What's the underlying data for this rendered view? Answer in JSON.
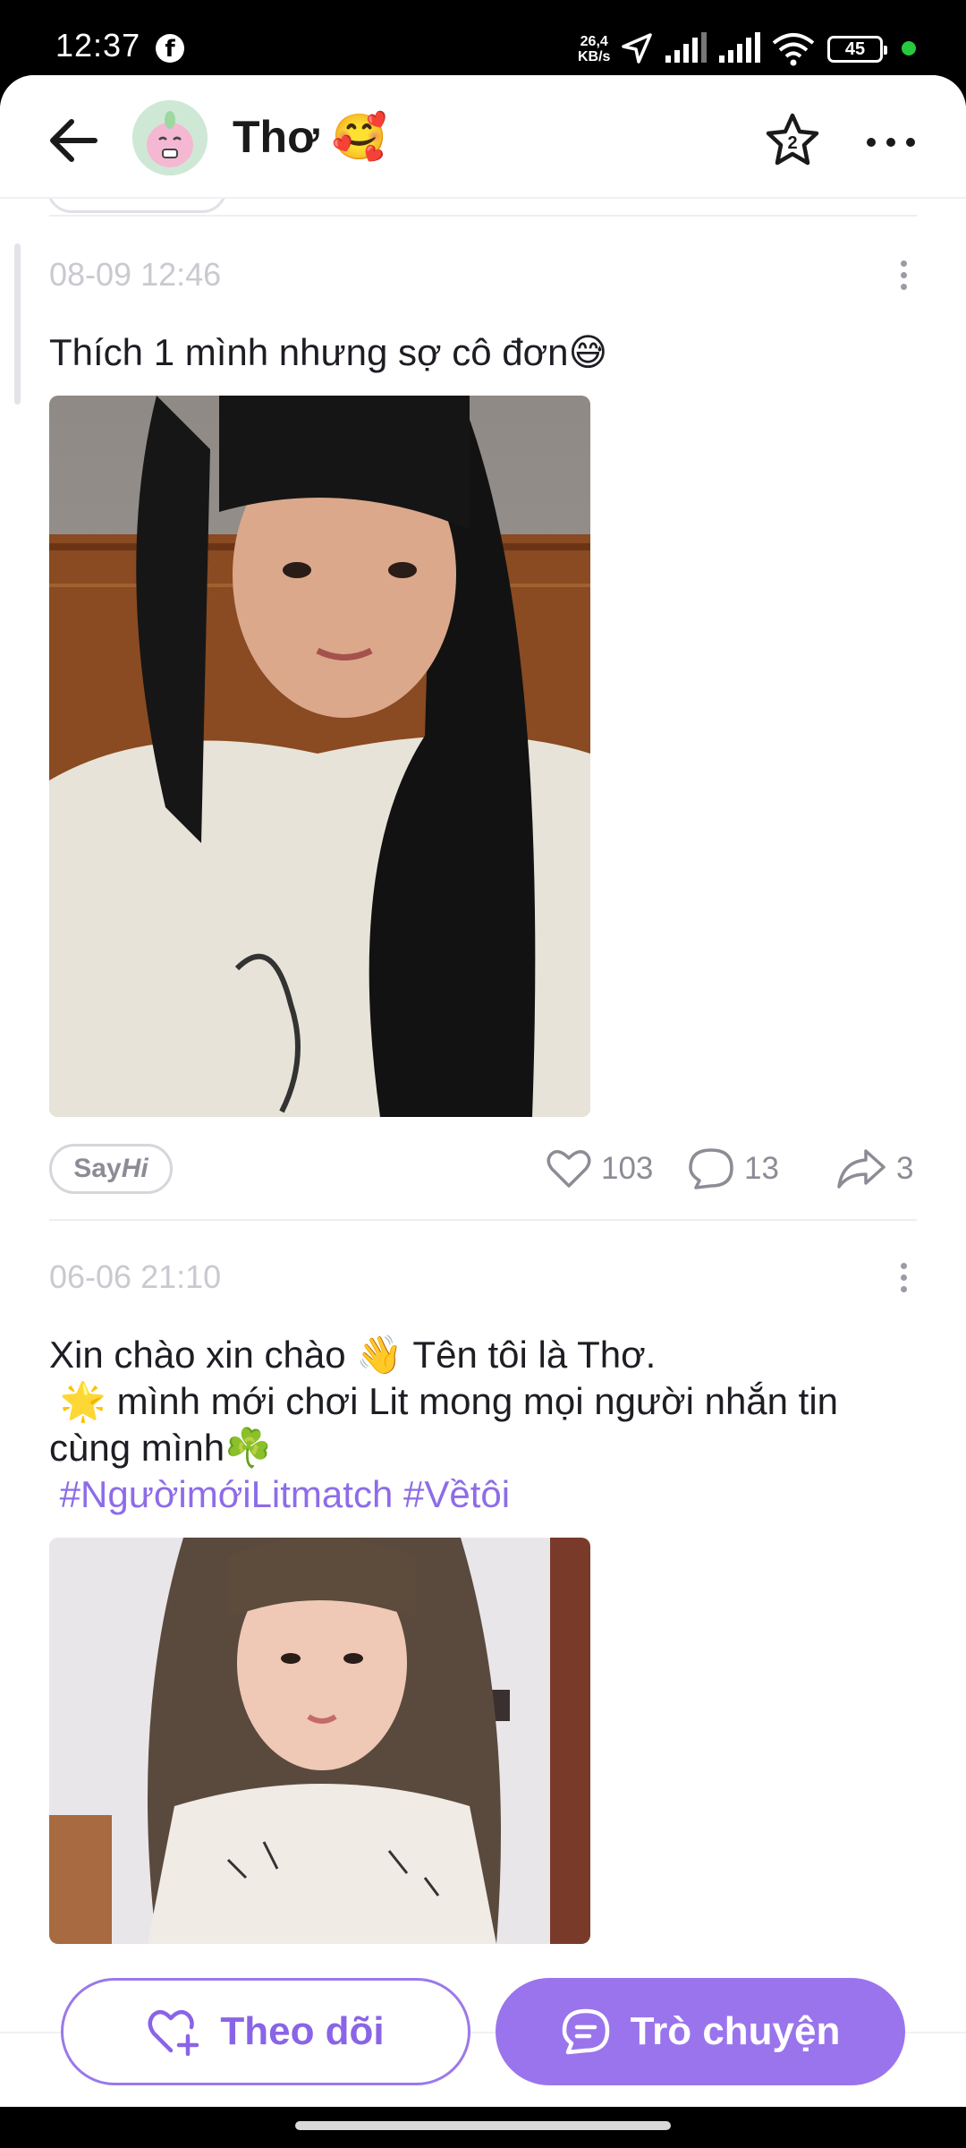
{
  "status_bar": {
    "time": "12:37",
    "net_speed_value": "26,4",
    "net_speed_unit": "KB/s",
    "battery": "45"
  },
  "header": {
    "username": "Thơ 🥰",
    "star_badge": "2"
  },
  "posts": [
    {
      "date": "08-09 12:46",
      "text": "Thích 1 mình nhưng sợ cô đơn😅",
      "hashtags": "",
      "sayhi_label": "Say",
      "sayhi_label_italic": "Hi",
      "likes": "103",
      "comments": "13",
      "shares": "3"
    },
    {
      "date": "06-06 21:10",
      "text_line1": "Xin chào xin chào 👋 Tên tôi là Thơ.",
      "text_line2": " 🌟 mình mới chơi Lit mong mọi người nhắn tin cùng mình☘️",
      "hashtags": " #NgườimớiLitmatch #Vềtôi"
    }
  ],
  "bottom_bar": {
    "follow_label": "Theo dõi",
    "chat_label": "Trò chuyện"
  },
  "colors": {
    "accent": "#9a74ec",
    "accent_text": "#8a64e6",
    "hashtag": "#8d6ce8",
    "muted": "#8c8c96"
  }
}
